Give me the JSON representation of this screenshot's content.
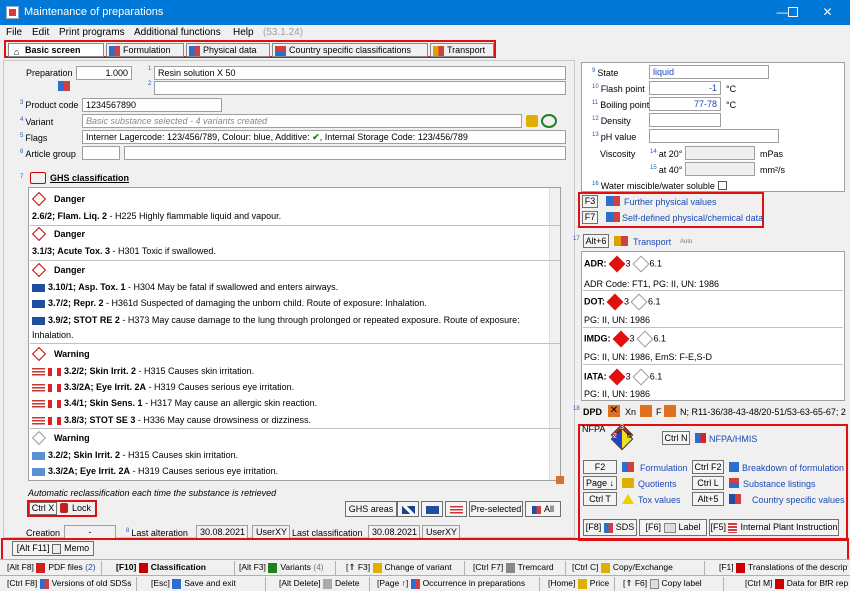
{
  "window": {
    "title": "Maintenance of preparations"
  },
  "menu": {
    "file": "File",
    "edit": "Edit",
    "print": "Print programs",
    "additional": "Additional functions",
    "help": "Help",
    "version": "(53.1.24)"
  },
  "tabs": [
    "Basic screen",
    "Formulation",
    "Physical data",
    "Country specific classifications",
    "Transport"
  ],
  "left": {
    "preparation_label": "Preparation",
    "preparation_value": "1.000",
    "name1_num": "1",
    "name1": "Resin solution X 50",
    "name2_num": "2",
    "name2": "",
    "product_code_num": "3",
    "product_code_label": "Product code",
    "product_code": "1234567890",
    "variant_num": "4",
    "variant_label": "Variant",
    "variant": "Basic substance selected - 4 variants created",
    "flags_num": "5",
    "flags_label": "Flags",
    "flags_a": "Interner Lagercode: 123/456/789, Colour: blue, Additive:",
    "flags_b": ", Internal Storage Code: 123/456/789",
    "article_num": "6",
    "article_label": "Article group",
    "ghs_num": "7",
    "ghs_title": "GHS classification"
  },
  "ghs": {
    "danger1": "Danger",
    "h225_code": "2.6/2",
    "h225_class": "; Flam. Liq. 2",
    "h225_text": " - H225 Highly flammable liquid and vapour.",
    "danger2": "Danger",
    "h301_code": "3.1/3",
    "h301_class": "; Acute Tox. 3",
    "h301_text": " - H301 Toxic if swallowed.",
    "danger3": "Danger",
    "h304_code": "3.10/1",
    "h304_class": "; Asp. Tox. 1",
    "h304_text": " - H304 May be fatal if swallowed and enters airways.",
    "h361_code": "3.7/2",
    "h361_class": "; Repr. 2",
    "h361_text": " - H361d Suspected of damaging the unborn child. Route of exposure: Inhalation.",
    "h373_code": "3.9/2",
    "h373_class": "; STOT RE 2",
    "h373_text": " - H373 May cause damage to the lung through prolonged or repeated exposure. Route of exposure:",
    "h373_cont": "Inhalation.",
    "warning1": "Warning",
    "h315_code": "3.2/2",
    "h315_class": "; Skin Irrit. 2",
    "h315_text": " - H315 Causes skin irritation.",
    "h319_code": "3.3/2A",
    "h319_class": "; Eye Irrit. 2A",
    "h319_text": " - H319 Causes serious eye irritation.",
    "h317_code": "3.4/1",
    "h317_class": "; Skin Sens. 1",
    "h317_text": " - H317 May cause an allergic skin reaction.",
    "h336_code": "3.8/3",
    "h336_class": "; STOT SE 3",
    "h336_text": " - H336 May cause drowsiness or dizziness.",
    "warning2": "Warning",
    "h315b_code": "3.2/2",
    "h315b_class": "; Skin Irrit. 2",
    "h315b_text": " - H315 Causes skin irritation.",
    "h319b_code": "3.3/2A",
    "h319b_class": "; Eye Irrit. 2A",
    "h319b_text": " - H319 Causes serious eye irritation.",
    "auto_reclass": "Automatic reclassification each time the substance is retrieved",
    "ctrlx": "Ctrl X",
    "lock": "Lock",
    "ghs_areas": "GHS areas",
    "preselected": "Pre-selected",
    "all": "All"
  },
  "footer_fields": {
    "creation_label": "Creation",
    "creation_value": "-",
    "last_alt_num": "8",
    "last_alt_label": "Last alteration",
    "last_alt_date": "30.08.2021",
    "last_alt_user": "UserXY",
    "last_class_label": "Last classification",
    "last_class_date": "30.08.2021",
    "last_class_user": "UserXY"
  },
  "phys": {
    "state_num": "9",
    "state_label": "State",
    "state": "liquid",
    "flash_num": "10",
    "flash_label": "Flash point",
    "flash": "-1",
    "flash_unit": "°C",
    "boil_num": "11",
    "boil_label": "Boiling point",
    "boil": "77-78",
    "boil_unit": "°C",
    "density_num": "12",
    "density_label": "Density",
    "ph_num": "13",
    "ph_label": "pH value",
    "visc_label": "Viscosity",
    "visc20_num": "14",
    "visc20_label": "at 20°",
    "visc20_unit": "mPas",
    "visc40_num": "15",
    "visc40_label": "at 40°",
    "visc40_unit": "mm²/s",
    "water_num": "16",
    "water_label": "Water miscible/water soluble",
    "f3": "F3",
    "further": "Further physical values",
    "f7": "F7",
    "selfdef": "Self-defined physical/chemical data"
  },
  "transport": {
    "num": "17",
    "alt6": "Alt+6",
    "title": "Transport",
    "auto": "Auto",
    "adr": "ADR:",
    "adr_nums": "3",
    "adr_61": "6.1",
    "adr_code": "ADR Code: FT1, PG: II, UN: 1986",
    "dot": "DOT:",
    "dot_nums": "3",
    "dot_61": "6.1",
    "dot_info": "PG: II, UN: 1986",
    "imdg": "IMDG:",
    "imdg_nums": "3",
    "imdg_61": "6.1",
    "imdg_info": "PG: II, UN: 1986, EmS: F-E,S-D",
    "iata": "IATA:",
    "iata_nums": "3",
    "iata_61": "6.1",
    "iata_info": "PG: II, UN: 1986"
  },
  "dpd": {
    "num": "18",
    "label": "DPD",
    "xn": "Xn",
    "f": "F",
    "text": "N; R11-36/38-43-48/20-51/53-63-65-67; 2"
  },
  "nfpa": {
    "label": "NFPA",
    "top": "3",
    "left": "2",
    "right": "0",
    "ctrln": "Ctrl N",
    "title": "NFPA/HMIS",
    "f2": "F2",
    "formulation": "Formulation",
    "ctrlf2": "Ctrl F2",
    "breakdown": "Breakdown of formulation",
    "pagedown": "Page ↓",
    "quotients": "Quotients",
    "ctrll": "Ctrl L",
    "substance": "Substance listings",
    "ctrlt": "Ctrl T",
    "tox": "Tox values",
    "alt5": "Alt+5",
    "country": "Country specific values",
    "f8": "[F8]",
    "sds": "SDS",
    "f6": "[F6]",
    "label_btn": "Label",
    "f5": "[F5]",
    "plant": "Internal Plant Instruction"
  },
  "bottom": {
    "altf11": "[Alt F11]",
    "memo": "Memo",
    "row1": [
      {
        "k": "[Alt F8]",
        "t": "PDF files",
        "n": "(2)"
      },
      {
        "k": "[F10]",
        "t": "Classification",
        "n": ""
      },
      {
        "k": "[Alt F3]",
        "t": "Variants",
        "n": "(4)"
      },
      {
        "k": "[⇑ F3]",
        "t": "Change of variant",
        "n": ""
      },
      {
        "k": "[Ctrl F7]",
        "t": "Tremcard",
        "n": ""
      },
      {
        "k": "[Ctrl C]",
        "t": "Copy/Exchange",
        "n": ""
      },
      {
        "k": "[F1]",
        "t": "Translations of the descriptions",
        "n": ""
      }
    ],
    "row2": [
      {
        "k": "[Ctrl F8]",
        "t": "Versions of old SDSs"
      },
      {
        "k": "[Esc]",
        "t": "Save and exit"
      },
      {
        "k": "[Alt Delete]",
        "t": "Delete"
      },
      {
        "k": "[Page ↑]",
        "t": "Occurrence in preparations"
      },
      {
        "k": "[Home]",
        "t": "Price"
      },
      {
        "k": "[⇑ F6]",
        "t": "Copy label"
      },
      {
        "k": "[Ctrl M]",
        "t": "Data for BfR report"
      }
    ]
  }
}
